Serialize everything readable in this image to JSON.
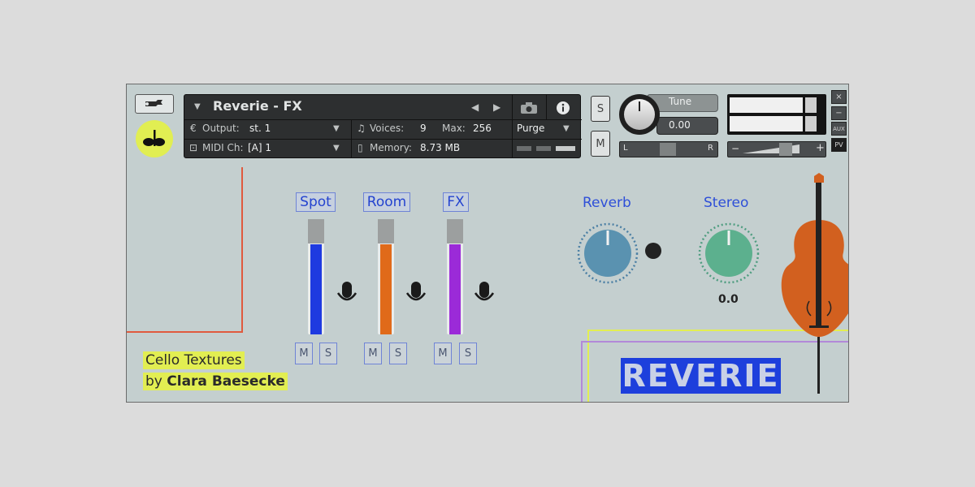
{
  "header": {
    "instrument_name": "Reverie - FX",
    "output_label": "Output:",
    "output_value": "st. 1",
    "midi_label": "MIDI Ch:",
    "midi_value": "[A]  1",
    "voices_label": "Voices:",
    "voices_value": "9",
    "max_label": "Max:",
    "max_value": "256",
    "memory_label": "Memory:",
    "memory_value": "8.73 MB",
    "purge_label": "Purge",
    "solo_label": "S",
    "mute_label": "M",
    "tune_label": "Tune",
    "tune_value": "0.00",
    "pan_left": "L",
    "pan_right": "R",
    "vol_minus": "−",
    "vol_plus": "+",
    "close": "×",
    "minimize": "−",
    "aux": "AUX",
    "pv": "PV"
  },
  "mixer": {
    "channels": [
      {
        "label": "Spot",
        "level": 0.78,
        "color": "#1e3ae0",
        "mute": "M",
        "solo": "S"
      },
      {
        "label": "Room",
        "level": 0.78,
        "color": "#e06a1a",
        "mute": "M",
        "solo": "S"
      },
      {
        "label": "FX",
        "level": 0.78,
        "color": "#9b2ad8",
        "mute": "M",
        "solo": "S"
      }
    ]
  },
  "knobs": {
    "reverb": {
      "label": "Reverb",
      "color": "#5a92b0"
    },
    "stereo": {
      "label": "Stereo",
      "color": "#5cb08e",
      "value": "0.0"
    }
  },
  "credits": {
    "line1": "Cello Textures",
    "line2_prefix": "by ",
    "line2_name": "Clara Baesecke"
  },
  "brand": "REVERIE",
  "colors": {
    "accent_yellow": "#e2ee52",
    "accent_blue": "#2e4fd8",
    "cello": "#d2601f"
  }
}
